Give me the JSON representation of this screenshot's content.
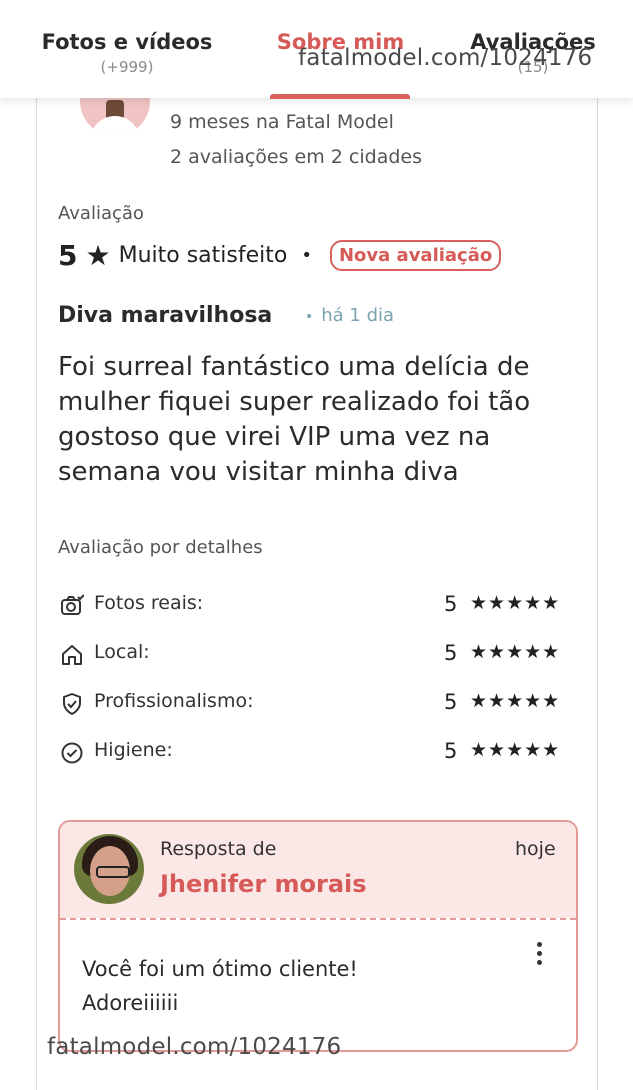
{
  "tabs": [
    {
      "label": "Fotos e vídeos",
      "count": "(+999)"
    },
    {
      "label": "Sobre mim",
      "count": ""
    },
    {
      "label": "Avaliações",
      "count": "(15)"
    }
  ],
  "watermark": "fatalmodel.com/1024176",
  "reviewer": {
    "time_on_site": "9 meses na Fatal Model",
    "reviews_summary": "2 avaliações em 2 cidades"
  },
  "review": {
    "section_label": "Avaliação",
    "score": "5",
    "star": "★",
    "score_text": "Muito satisfeito",
    "separator": "•",
    "badge": "Nova avaliação",
    "title": "Diva maravilhosa",
    "time_dot": "•",
    "time": "há 1 dia",
    "body": "Foi surreal fantástico uma delícia de mulher fiquei super realizado foi tão gostoso que virei VIP uma vez na semana vou visitar minha diva"
  },
  "details": {
    "label": "Avaliação por detalhes",
    "items": [
      {
        "name": "Fotos reais:",
        "score": "5",
        "stars": "★★★★★",
        "icon": "camera-icon"
      },
      {
        "name": "Local:",
        "score": "5",
        "stars": "★★★★★",
        "icon": "home-icon"
      },
      {
        "name": "Profissionalismo:",
        "score": "5",
        "stars": "★★★★★",
        "icon": "shield-check-icon"
      },
      {
        "name": "Higiene:",
        "score": "5",
        "stars": "★★★★★",
        "icon": "check-circle-icon"
      }
    ]
  },
  "reply": {
    "from_label": "Resposta de",
    "name": "Jhenifer morais",
    "when": "hoje",
    "text_line1": "Você foi um ótimo cliente!",
    "text_line2": "Adoreiiiiii"
  },
  "colors": {
    "accent": "#d65a57",
    "reply_bg": "#fbe7e6",
    "reply_border": "#e49a97",
    "time_color": "#7aa3b0"
  }
}
